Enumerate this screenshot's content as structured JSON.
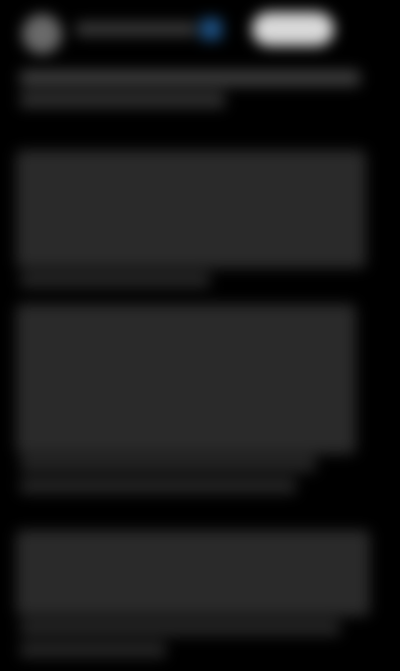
{
  "app": {
    "background": "#000000"
  },
  "header": {
    "avatar_icon": "avatar-icon",
    "verified_icon": "verified-badge-icon",
    "verified_color": "#1d4f80",
    "follow_button_color": "#d9d9d9"
  },
  "post": {
    "paragraph_count": 4
  }
}
